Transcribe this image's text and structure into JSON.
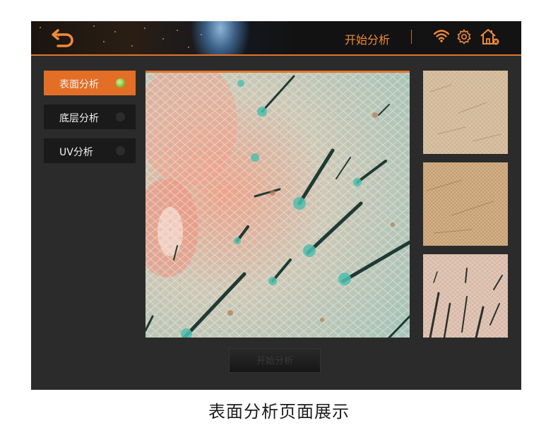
{
  "header": {
    "title": "开始分析"
  },
  "sidebar": {
    "items": [
      {
        "label": "表面分析",
        "active": true
      },
      {
        "label": "底层分析",
        "active": false
      },
      {
        "label": "UV分析",
        "active": false
      }
    ]
  },
  "icons": {
    "back": "back-arrow-icon",
    "wifi": "wifi-icon",
    "settings": "gear-icon",
    "home": "home-icon"
  },
  "analyze_button": {
    "label": "开始分析"
  },
  "caption": "表面分析页面展示",
  "colors": {
    "accent": "#e36f26",
    "background": "#2b2b2b",
    "indicator_on": "#7cc43e"
  }
}
